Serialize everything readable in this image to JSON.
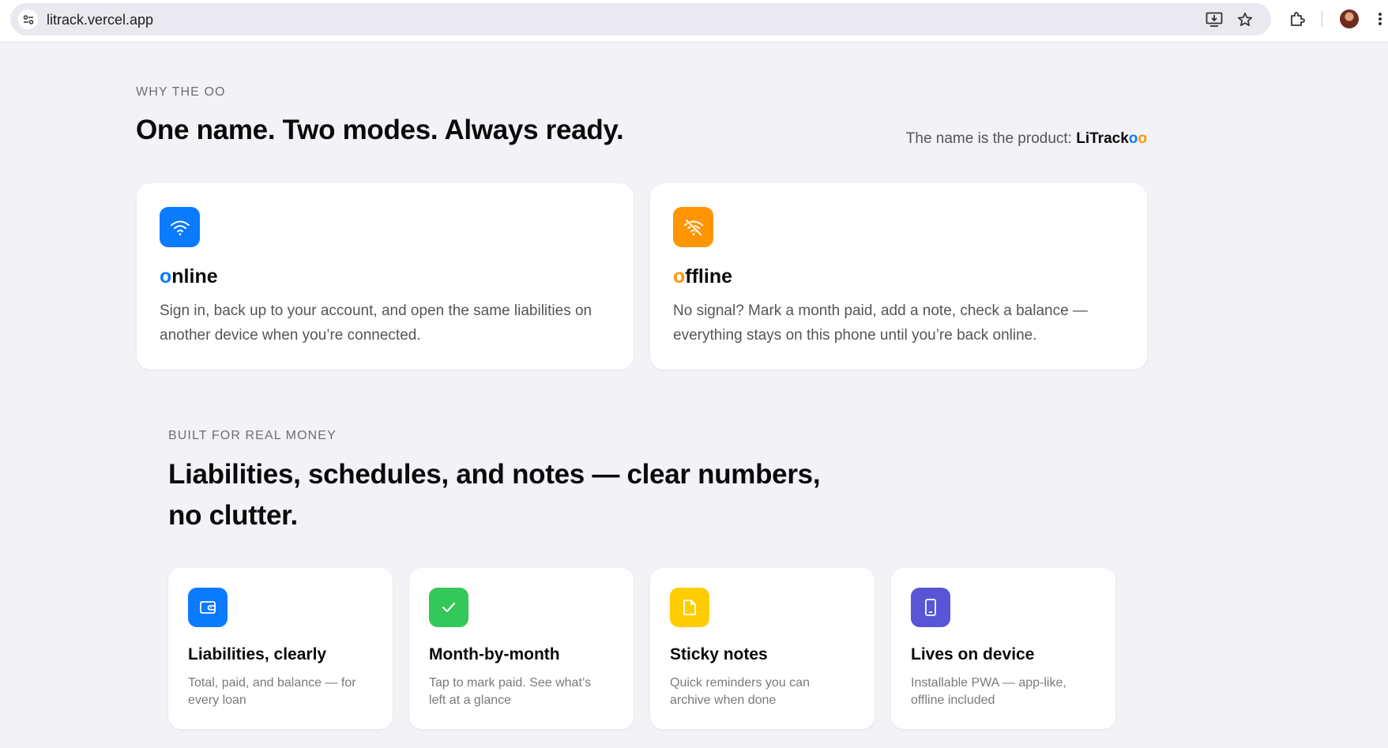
{
  "browser": {
    "url": "litrack.vercel.app",
    "icons": [
      "site-info-icon",
      "install-app-icon",
      "bookmark-star-icon",
      "extensions-icon",
      "profile-avatar",
      "more-menu-icon"
    ]
  },
  "why": {
    "eyebrow": "WHY THE OO",
    "title": "One name. Two modes. Always ready.",
    "product_note_prefix": "The name is the product: ",
    "product_name_main": "LiTrack",
    "product_name_o1": "o",
    "product_name_o2": "o"
  },
  "modes": [
    {
      "icon": "wifi-icon",
      "icon_color": "#0a7aff",
      "title_first": "o",
      "title_rest": "nline",
      "first_color": "#0a7aff",
      "desc": "Sign in, back up to your account, and open the same liabilities on another device when you’re connected."
    },
    {
      "icon": "wifi-off-icon",
      "icon_color": "#ff9500",
      "title_first": "o",
      "title_rest": "ffline",
      "first_color": "#ff9500",
      "desc": "No signal? Mark a month paid, add a note, check a balance — everything stays on this phone until you’re back online."
    }
  ],
  "built": {
    "eyebrow": "BUILT FOR REAL MONEY",
    "title": "Liabilities, schedules, and notes — clear numbers, no clutter."
  },
  "features": [
    {
      "icon": "wallet-icon",
      "icon_color": "#0a7aff",
      "title": "Liabilities, clearly",
      "desc": "Total, paid, and balance — for every loan"
    },
    {
      "icon": "checkmark-icon",
      "icon_color": "#34c759",
      "title": "Month-by-month",
      "desc": "Tap to mark paid. See what’s left at a glance"
    },
    {
      "icon": "note-icon",
      "icon_color": "#ffcc00",
      "title": "Sticky notes",
      "desc": "Quick reminders you can archive when done"
    },
    {
      "icon": "phone-icon",
      "icon_color": "#5856d6",
      "title": "Lives on device",
      "desc": "Installable PWA — app-like, offline included"
    }
  ]
}
